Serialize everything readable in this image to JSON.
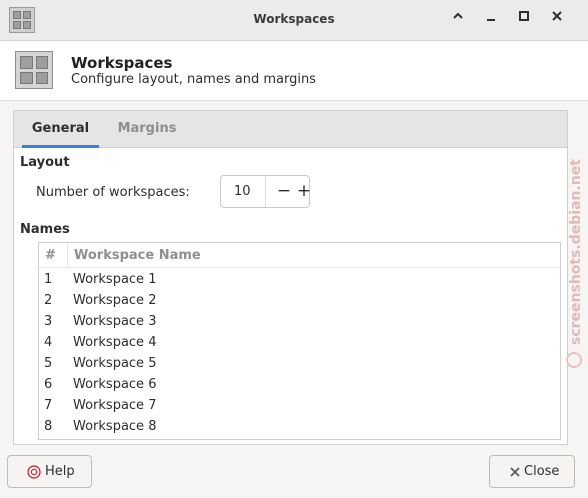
{
  "window": {
    "title": "Workspaces"
  },
  "header": {
    "title": "Workspaces",
    "subtitle": "Configure layout, names and margins"
  },
  "tabs": [
    {
      "label": "General",
      "active": true
    },
    {
      "label": "Margins",
      "active": false
    }
  ],
  "layout": {
    "section_label": "Layout",
    "number_label": "Number of workspaces:",
    "number_value": "10",
    "decrement_glyph": "−",
    "increment_glyph": "+"
  },
  "names": {
    "section_label": "Names",
    "columns": [
      "#",
      "Workspace Name"
    ],
    "rows": [
      {
        "num": "1",
        "name": "Workspace 1"
      },
      {
        "num": "2",
        "name": "Workspace 2"
      },
      {
        "num": "3",
        "name": "Workspace 3"
      },
      {
        "num": "4",
        "name": "Workspace 4"
      },
      {
        "num": "5",
        "name": "Workspace 5"
      },
      {
        "num": "6",
        "name": "Workspace 6"
      },
      {
        "num": "7",
        "name": "Workspace 7"
      },
      {
        "num": "8",
        "name": "Workspace 8"
      }
    ]
  },
  "buttons": {
    "help": "Help",
    "close": "Close"
  },
  "watermark": "screenshots.debian.net",
  "colors": {
    "accent": "#3584e4",
    "window_bg": "#f6f5f4",
    "titlebar": "#ebebeb"
  }
}
